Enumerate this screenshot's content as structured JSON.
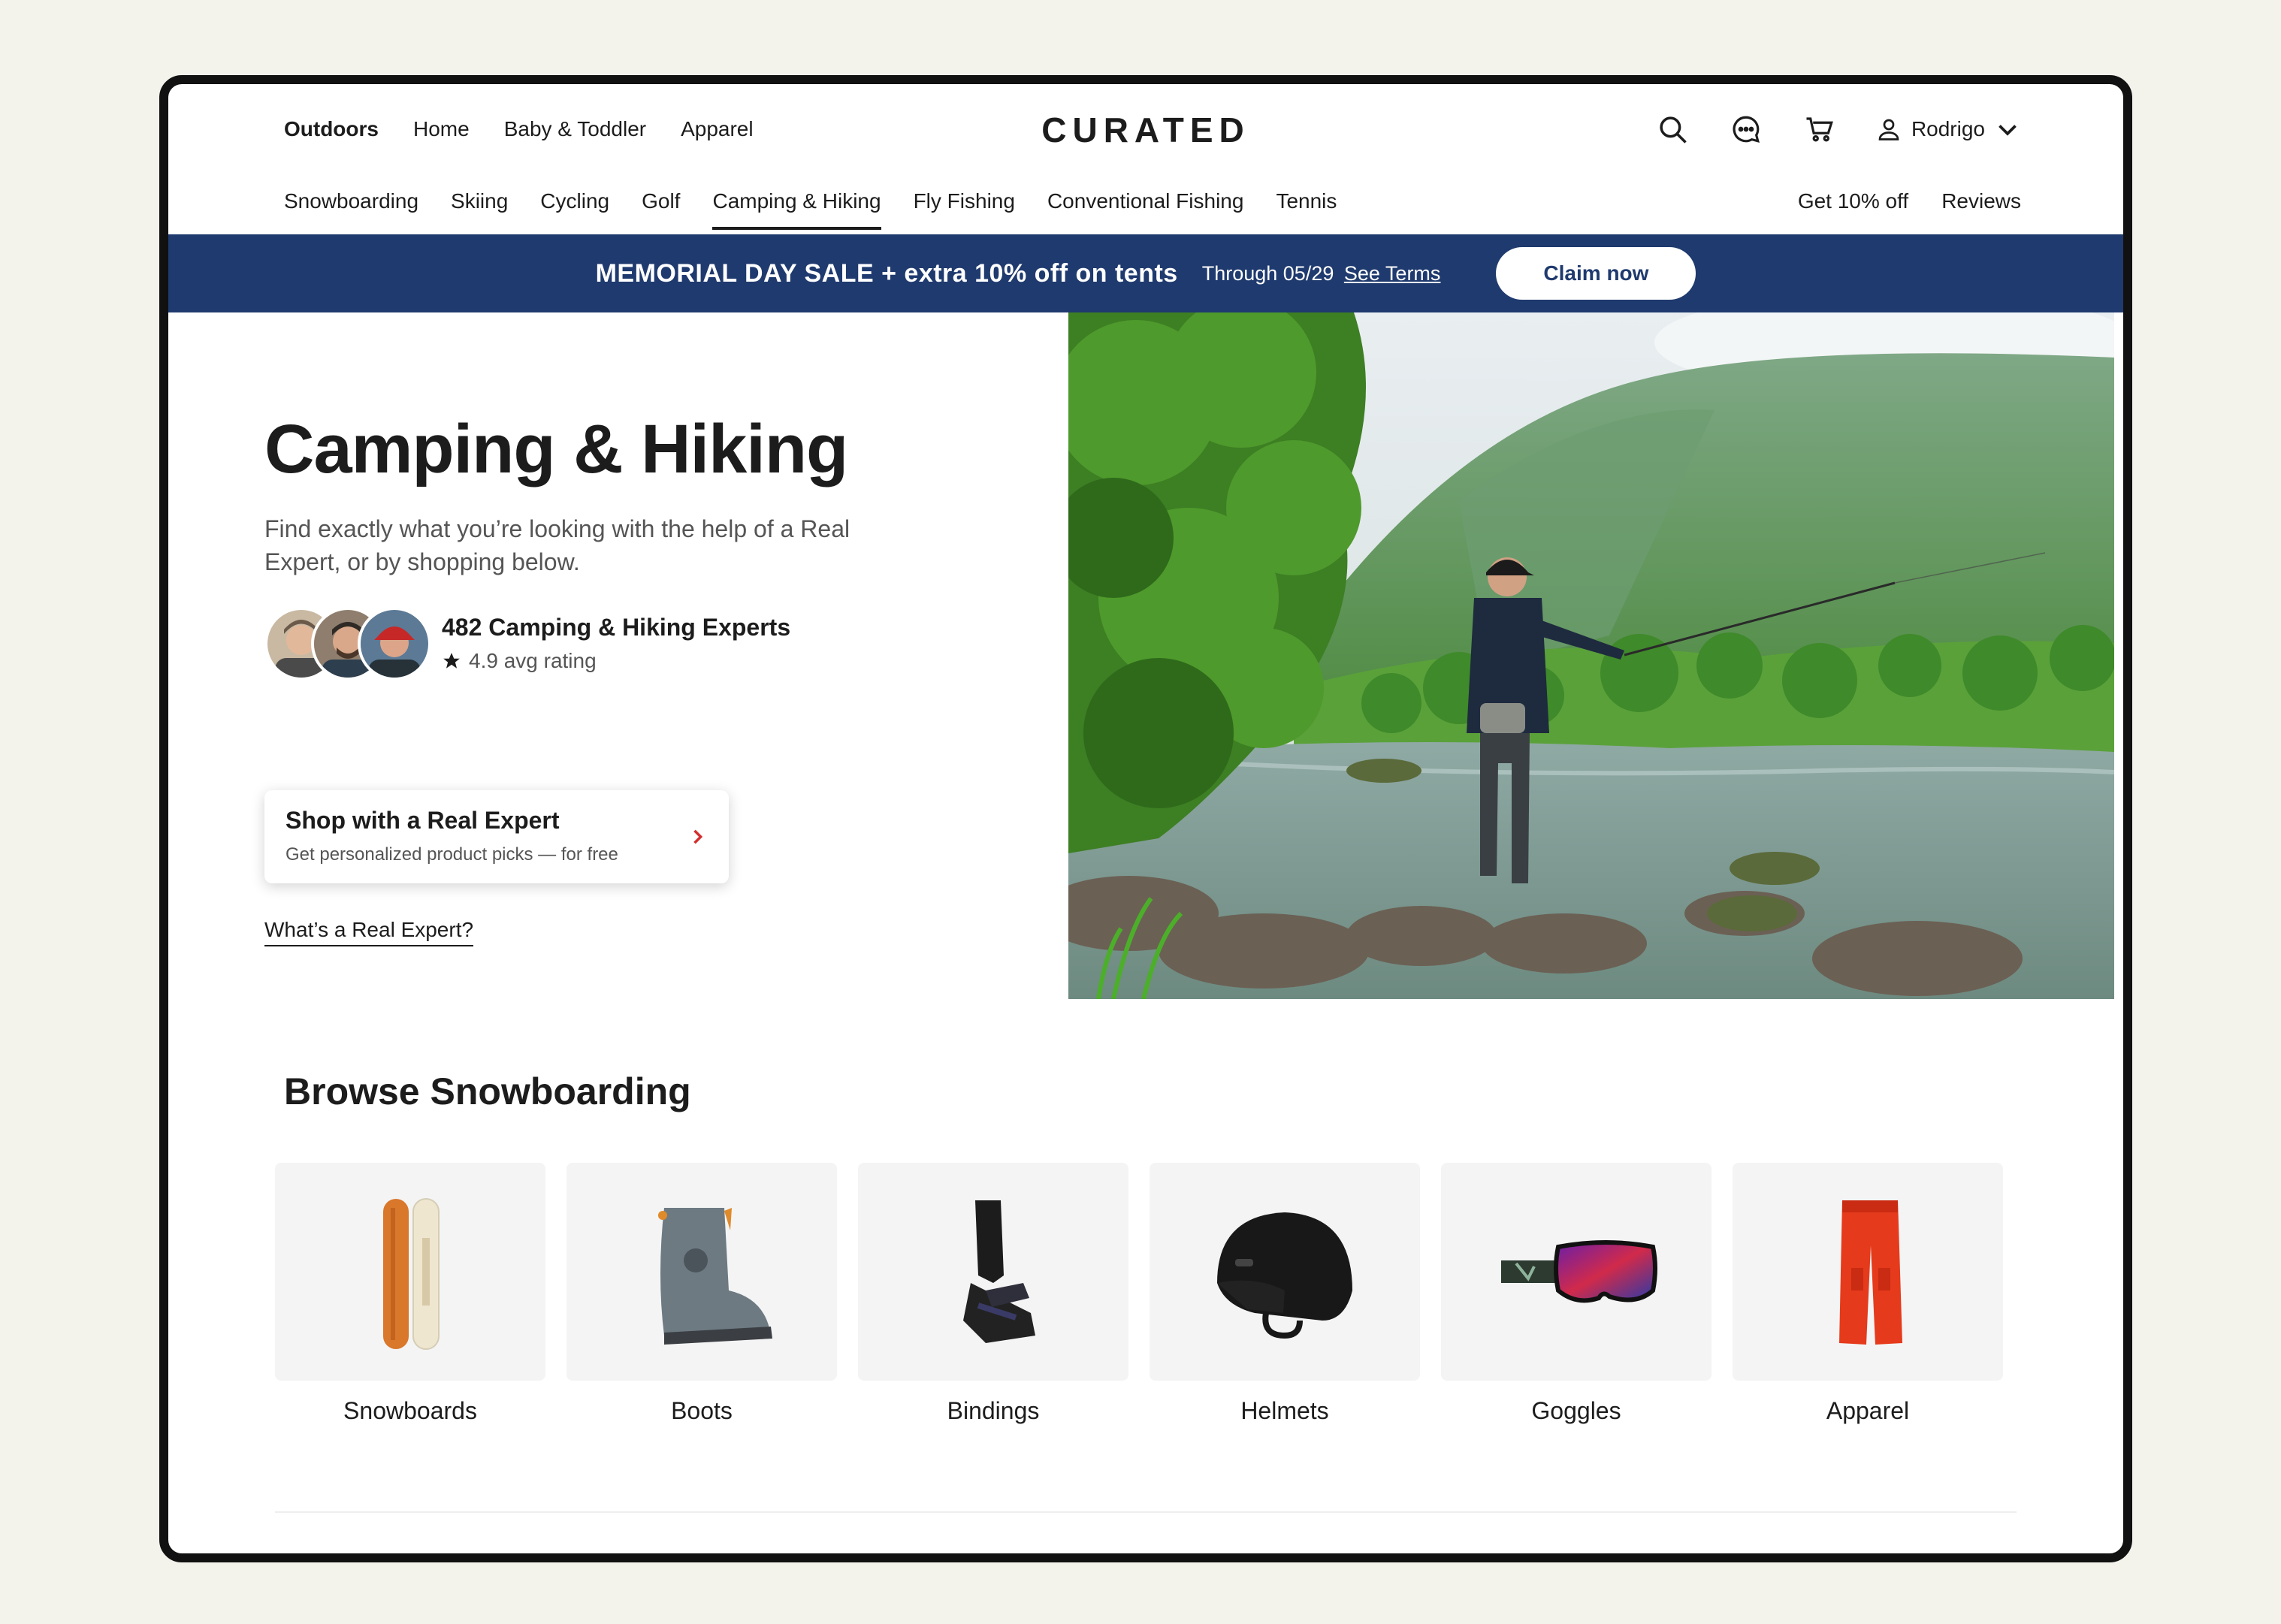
{
  "topnav": {
    "primary": [
      "Outdoors",
      "Home",
      "Baby & Toddler",
      "Apparel"
    ],
    "logo": "CURATED",
    "user": "Rodrigo"
  },
  "subnav": {
    "categories": [
      "Snowboarding",
      "Skiing",
      "Cycling",
      "Golf",
      "Camping & Hiking",
      "Fly Fishing",
      "Conventional Fishing",
      "Tennis"
    ],
    "active_category": "Camping & Hiking",
    "links": [
      "Get 10% off",
      "Reviews"
    ]
  },
  "promo": {
    "headline": "MEMORIAL DAY SALE + extra 10% off on tents",
    "through": "Through 05/29",
    "terms": "See Terms",
    "cta": "Claim now"
  },
  "hero": {
    "title": "Camping & Hiking",
    "description": "Find exactly what you’re looking with the help of a Real Expert, or by shopping below.",
    "experts_count": "482 Camping & Hiking  Experts",
    "rating": "4.9 avg rating",
    "card_title": "Shop with a Real Expert",
    "card_subtitle": "Get personalized product picks — for free",
    "expert_link": "What’s a Real Expert?"
  },
  "browse": {
    "title": "Browse Snowboarding",
    "items": [
      {
        "label": "Snowboards",
        "icon": "snowboard-icon"
      },
      {
        "label": "Boots",
        "icon": "boot-icon"
      },
      {
        "label": "Bindings",
        "icon": "binding-icon"
      },
      {
        "label": "Helmets",
        "icon": "helmet-icon"
      },
      {
        "label": "Goggles",
        "icon": "goggles-icon"
      },
      {
        "label": "Apparel",
        "icon": "pants-icon"
      }
    ]
  },
  "colors": {
    "promo_bg": "#1f3a6e",
    "accent_red": "#d32f2f"
  }
}
